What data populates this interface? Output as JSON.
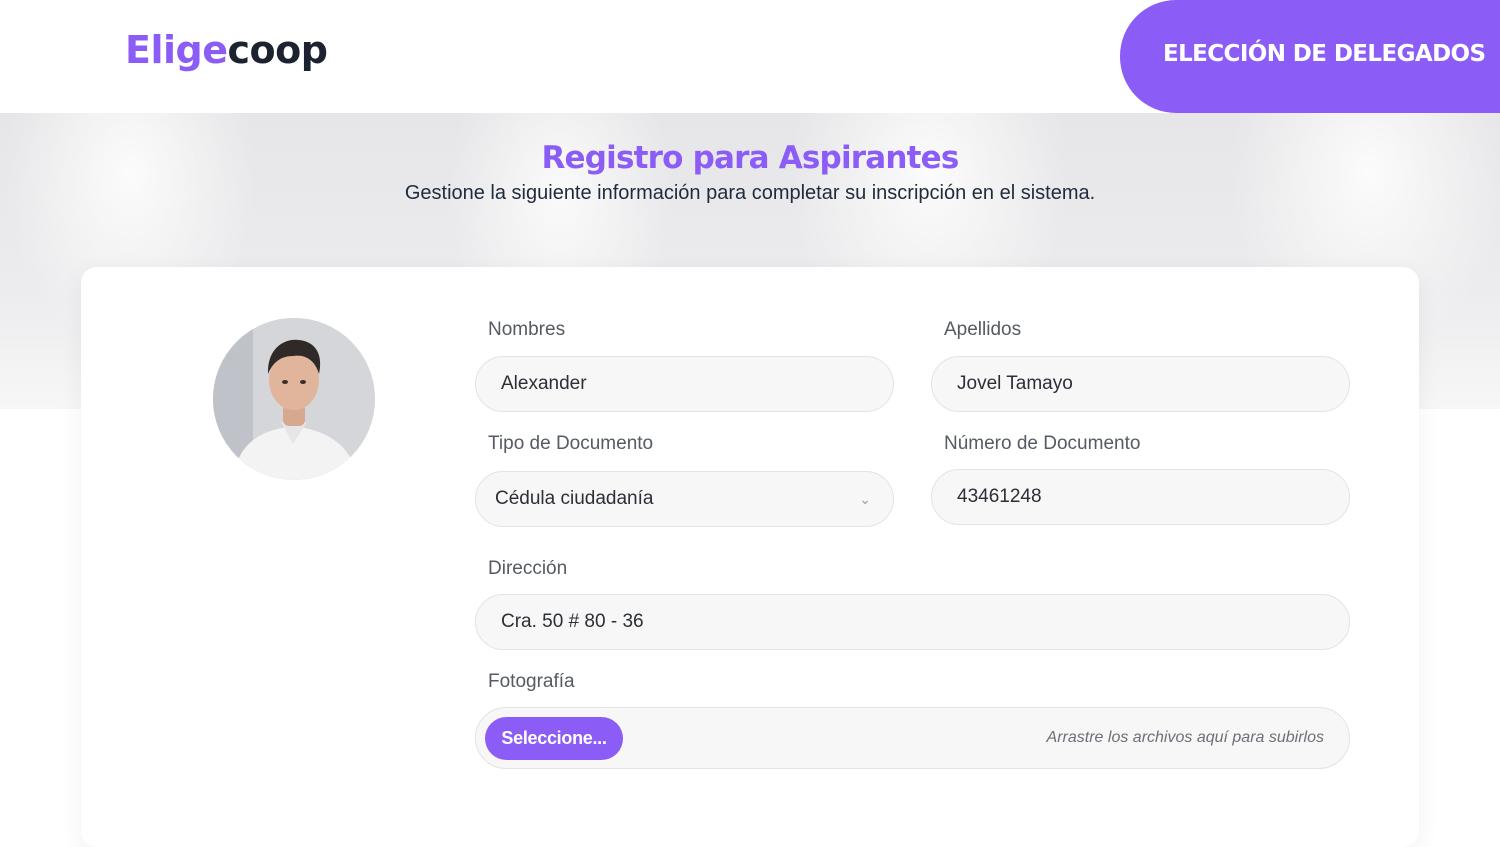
{
  "header": {
    "logo_part1": "Elige",
    "logo_part2": "coop",
    "badge": "ELECCIÓN DE DELEGADOS"
  },
  "hero": {
    "title": "Registro para Aspirantes",
    "subtitle": "Gestione la siguiente información para completar su inscripción en el sistema."
  },
  "form": {
    "nombres_label": "Nombres",
    "nombres_value": "Alexander",
    "apellidos_label": "Apellidos",
    "apellidos_value": "Jovel Tamayo",
    "tipo_label": "Tipo de Documento",
    "tipo_value": "Cédula ciudadanía",
    "numero_label": "Número de Documento",
    "numero_value": "43461248",
    "direccion_label": "Dirección",
    "direccion_value": "Cra. 50 # 80 - 36",
    "foto_label": "Fotografía",
    "foto_button": "Seleccione...",
    "foto_hint": "Arrastre los archivos aquí para subirlos"
  },
  "icons": {
    "avatar": "user-photo",
    "select": "chevron-down-icon"
  },
  "colors": {
    "accent": "#8b5cf6",
    "dark": "#1c2230"
  }
}
